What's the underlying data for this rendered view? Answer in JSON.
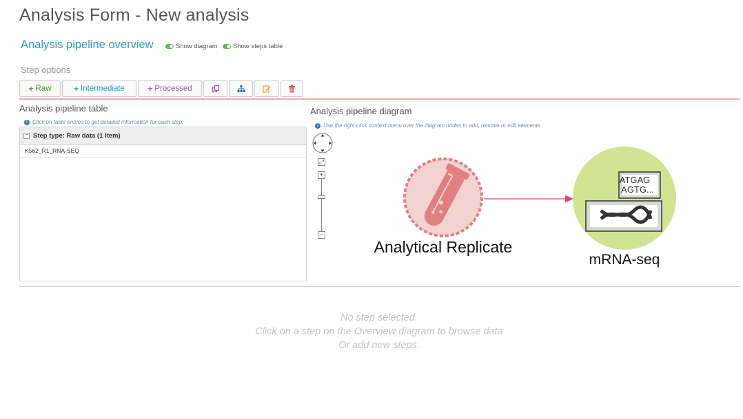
{
  "page": {
    "title": "Analysis Form - New analysis"
  },
  "overview": {
    "title": "Analysis pipeline overview",
    "toggles": [
      {
        "label": "Show diagram",
        "on": true
      },
      {
        "label": "Show steps table",
        "on": true
      }
    ]
  },
  "step_options": {
    "label": "Step options",
    "buttons": {
      "raw": "Raw",
      "intermediate": "Intermediate",
      "processed": "Processed"
    },
    "icon_buttons": [
      "copy-icon",
      "sitemap-icon",
      "edit-icon",
      "trash-icon"
    ],
    "colors": {
      "raw": "#4a9a2f",
      "intermediate": "#2b9ac6",
      "processed": "#9b59b6",
      "edit": "#e5a013",
      "delete": "#d9534f"
    }
  },
  "table": {
    "title": "Analysis pipeline table",
    "hint": "Click on table entries to get detailed information for each step.",
    "group_header": "Step type: Raw data (1 Item)",
    "rows": [
      "K562_R1_RNA-SEQ"
    ]
  },
  "diagram": {
    "title": "Analysis pipeline diagram",
    "hint": "Use the right-click context menu over the diagram nodes to add, remove or edit elements.",
    "nodes": [
      {
        "label": "Analytical Replicate",
        "icon": "test-tube-icon",
        "color": "#e08080"
      },
      {
        "label": "mRNA-seq",
        "icon": "sequencer-icon",
        "color": "#d2e394",
        "seq_text_1": "ATGAG",
        "seq_text_2": "AGTG..."
      }
    ],
    "edge_color": "#e0457b"
  },
  "empty_state": {
    "line1": "No step selected.",
    "line2": "Click on a step on the Overview diagram to browse data",
    "line3": "Or add new steps."
  }
}
